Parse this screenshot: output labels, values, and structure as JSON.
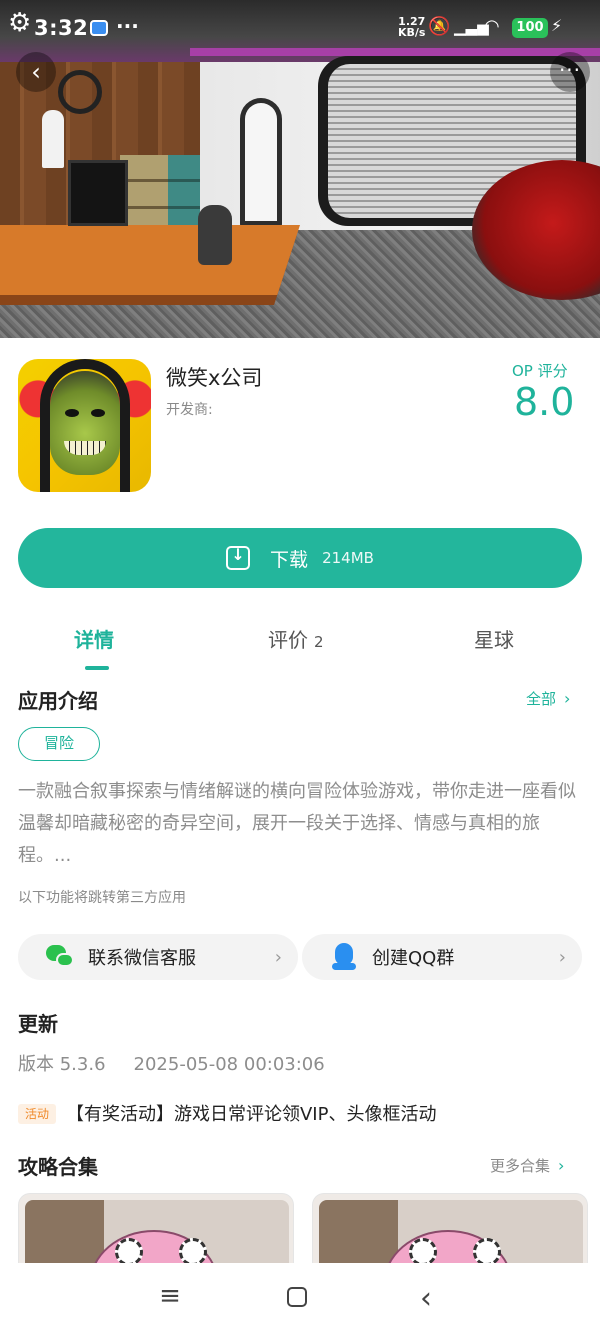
{
  "status_bar": {
    "time": "3:32",
    "dots": "···",
    "network_speed": "1.27",
    "network_unit": "KB/s",
    "battery": "100",
    "icons": [
      "settings-gear-icon",
      "notification-icon",
      "mute-icon",
      "signal-icon",
      "wifi-icon",
      "battery-icon",
      "charging-icon"
    ]
  },
  "header": {
    "back_icon": "‹",
    "more_icon": "···"
  },
  "app": {
    "name": "微笑x公司",
    "developer_label": "开发商:",
    "score_label": "OP 评分",
    "score": "8.0"
  },
  "download": {
    "label": "下载",
    "size": "214MB"
  },
  "tabs": [
    {
      "label": "详情",
      "count": ""
    },
    {
      "label": "评价",
      "count": "2"
    },
    {
      "label": "星球",
      "count": ""
    }
  ],
  "intro": {
    "title": "应用介绍",
    "all_link": "全部",
    "tag": "冒险",
    "description": "一款融合叙事探索与情绪解谜的横向冒险体验游戏，带你走进一座看似温馨却暗藏秘密的奇异空间，展开一段关于选择、情感与真相的旅程。...",
    "third_party_note": "以下功能将跳转第三方应用"
  },
  "actions": [
    {
      "label": "联系微信客服",
      "icon": "wechat-icon"
    },
    {
      "label": "创建QQ群",
      "icon": "qq-icon"
    }
  ],
  "update": {
    "title": "更新",
    "version": "版本 5.3.6",
    "date": "2025-05-08 00:03:06"
  },
  "event": {
    "badge": "活动",
    "text": "【有奖活动】游戏日常评论领VIP、头像框活动"
  },
  "guides": {
    "title": "攻略合集",
    "more_link": "更多合集"
  },
  "nav": {
    "menu": "≡",
    "back": "‹"
  },
  "colors": {
    "accent": "#23b69c",
    "event": "#f08a2a",
    "wechat": "#2bc14e",
    "qq": "#2a8ff0"
  }
}
